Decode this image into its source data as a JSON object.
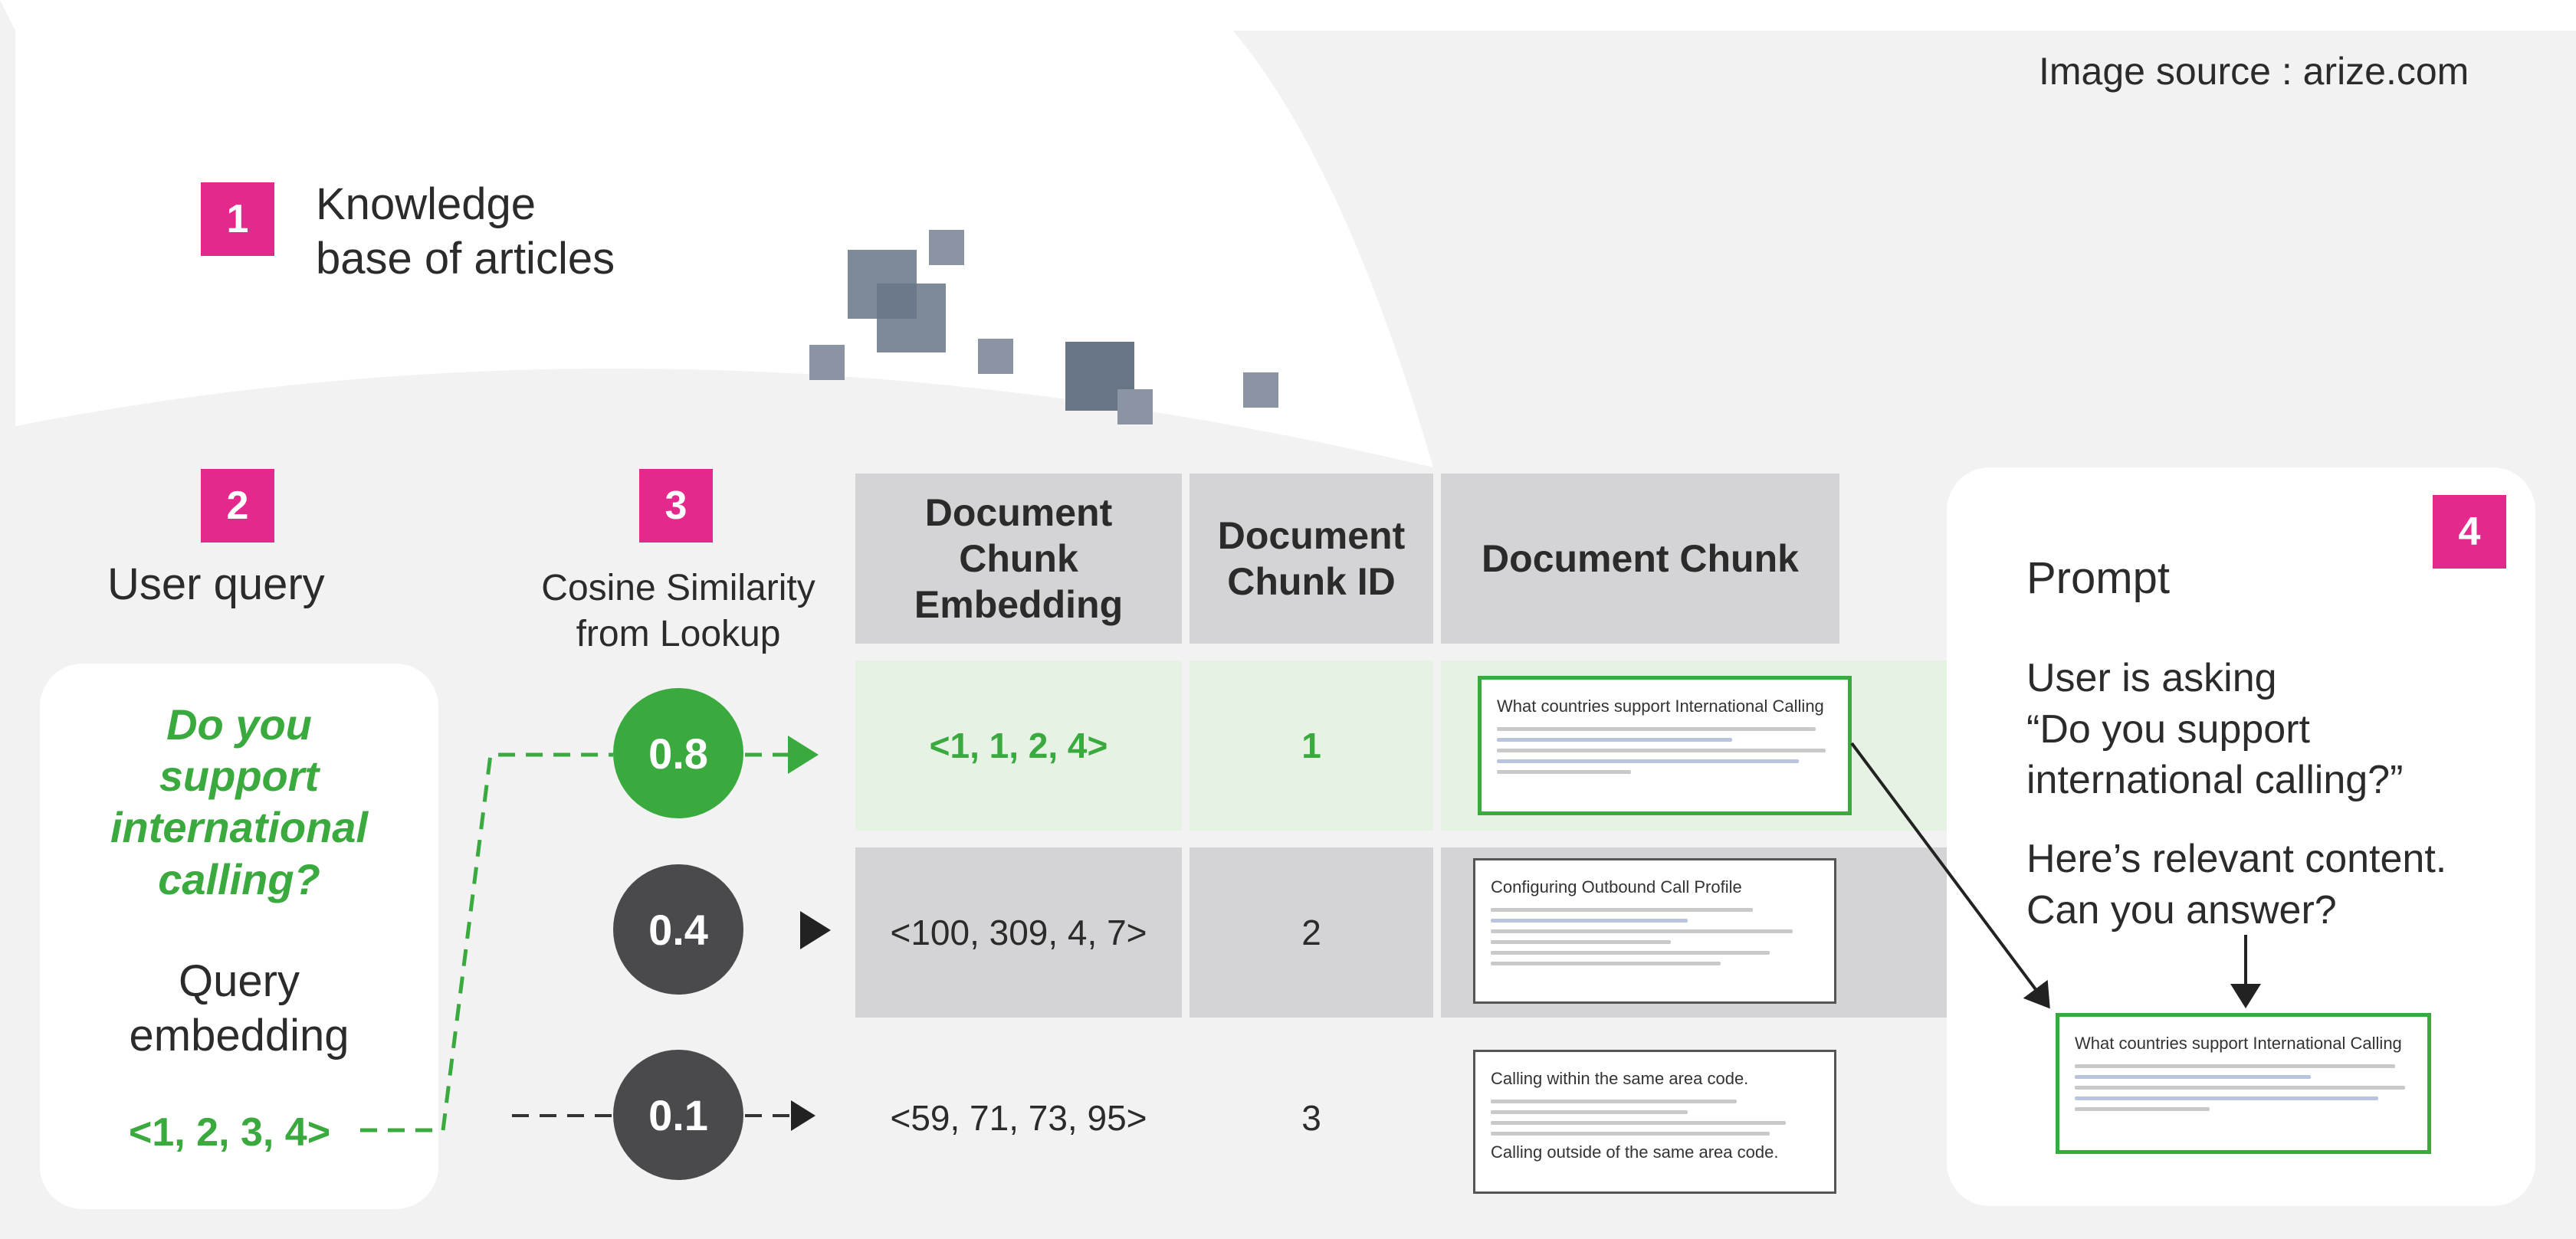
{
  "source": "Image source : arize.com",
  "step1": {
    "number": "1",
    "title_line1": "Knowledge",
    "title_line2": "base of articles"
  },
  "step2": {
    "number": "2",
    "title": "User query",
    "query_line1": "Do you",
    "query_line2": "support",
    "query_line3": "international",
    "query_line4": "calling?",
    "embedding_label_line1": "Query",
    "embedding_label_line2": "embedding",
    "embedding_value": "<1, 2, 3, 4>"
  },
  "step3": {
    "number": "3",
    "title_line1": "Cosine Similarity",
    "title_line2": "from Lookup"
  },
  "table": {
    "headers": [
      "Document Chunk Embedding",
      "Document Chunk ID",
      "Document Chunk"
    ],
    "header_lines": {
      "embedding": [
        "Document",
        "Chunk",
        "Embedding"
      ],
      "id": [
        "Document",
        "Chunk ID"
      ],
      "chunk": [
        "Document Chunk"
      ]
    },
    "rows": [
      {
        "similarity": "0.8",
        "embedding": "<1, 1, 2, 4>",
        "id": "1",
        "doc_title": "What countries support International Calling"
      },
      {
        "similarity": "0.4",
        "embedding": "<100, 309, 4, 7>",
        "id": "2",
        "doc_title": "Configuring Outbound Call Profile"
      },
      {
        "similarity": "0.1",
        "embedding": "<59, 71, 73, 95>",
        "id": "3",
        "doc_title": "Calling within the same area code.",
        "doc_footer": "Calling outside of the same area code."
      }
    ]
  },
  "step4": {
    "number": "4",
    "title": "Prompt",
    "line1": "User is asking",
    "line2": "“Do you support",
    "line3": "international calling?”",
    "line4": "Here’s relevant content.",
    "line5": "Can you answer?",
    "doc_title": "What countries support International Calling"
  },
  "colors": {
    "accent_pink": "#e5288c",
    "green": "#3aaa3f",
    "dark_circle": "#4a4a4d",
    "highlight_row": "#e6f2e4",
    "grey_row": "#d4d4d6"
  }
}
